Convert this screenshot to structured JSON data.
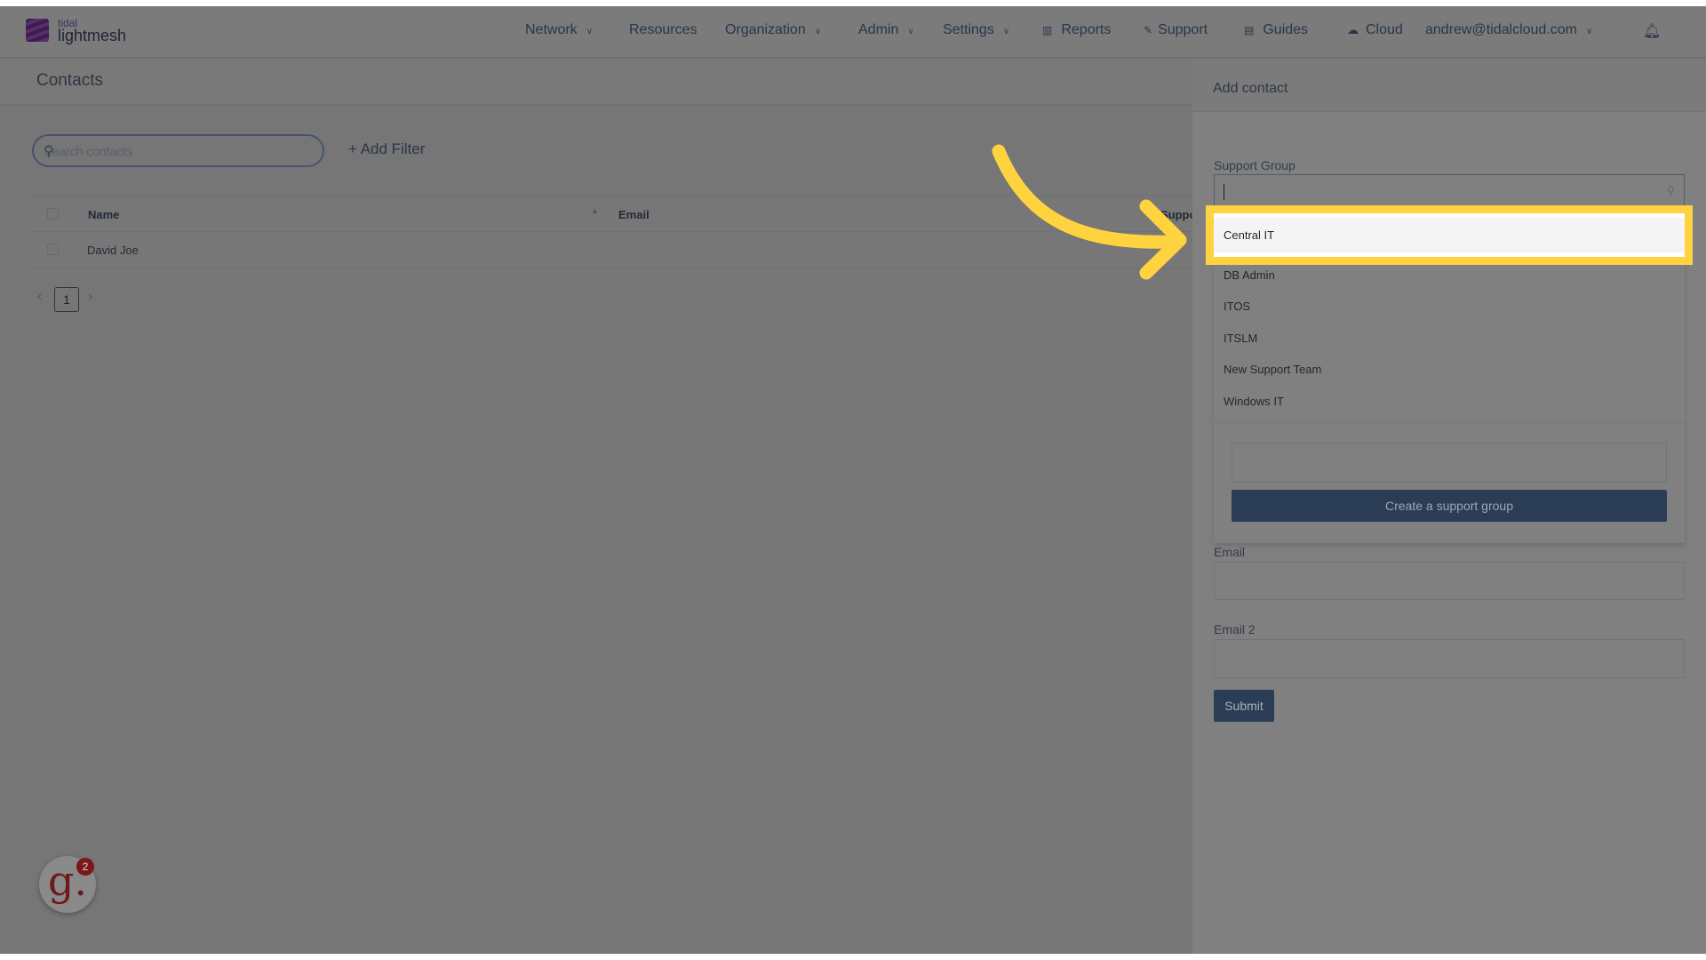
{
  "app": {
    "brand_small": "tidal",
    "brand_large": "lightmesh"
  },
  "nav": {
    "items": [
      {
        "label": "Network",
        "dropdown": true
      },
      {
        "label": "Resources",
        "dropdown": false
      },
      {
        "label": "Organization",
        "dropdown": true
      },
      {
        "label": "Admin",
        "dropdown": true
      },
      {
        "label": "Settings",
        "dropdown": true
      },
      {
        "label": "Reports",
        "icon": "bar-chart-icon"
      },
      {
        "label": "Support",
        "icon": "wrench-icon"
      },
      {
        "label": "Guides",
        "icon": "book-icon"
      },
      {
        "label": "Cloud",
        "icon": "cloud-icon"
      }
    ],
    "user": "andrew@tidalcloud.com"
  },
  "contacts": {
    "title": "Contacts",
    "search_placeholder": "Search contacts",
    "add_filter": "+ Add Filter",
    "columns": [
      "Name",
      "Email",
      "Suppor"
    ],
    "rows": [
      {
        "name": "David Joe"
      }
    ],
    "page": "1"
  },
  "panel": {
    "title": "Add contact",
    "support_group_label": "Support Group",
    "support_group_value": "",
    "options": [
      "Central IT",
      "DB Admin",
      "ITOS",
      "ITSLM",
      "New Support Team",
      "Windows IT"
    ],
    "highlighted_option": "Central IT",
    "new_group_value": "",
    "create_button": "Create a support group",
    "email_label": "Email",
    "email_value": "",
    "email2_label": "Email 2",
    "email2_value": "",
    "submit": "Submit"
  },
  "widget": {
    "badge_count": "2",
    "letter": "g."
  },
  "colors": {
    "highlight": "#ffd23f",
    "primary_button": "#2b3d55"
  }
}
